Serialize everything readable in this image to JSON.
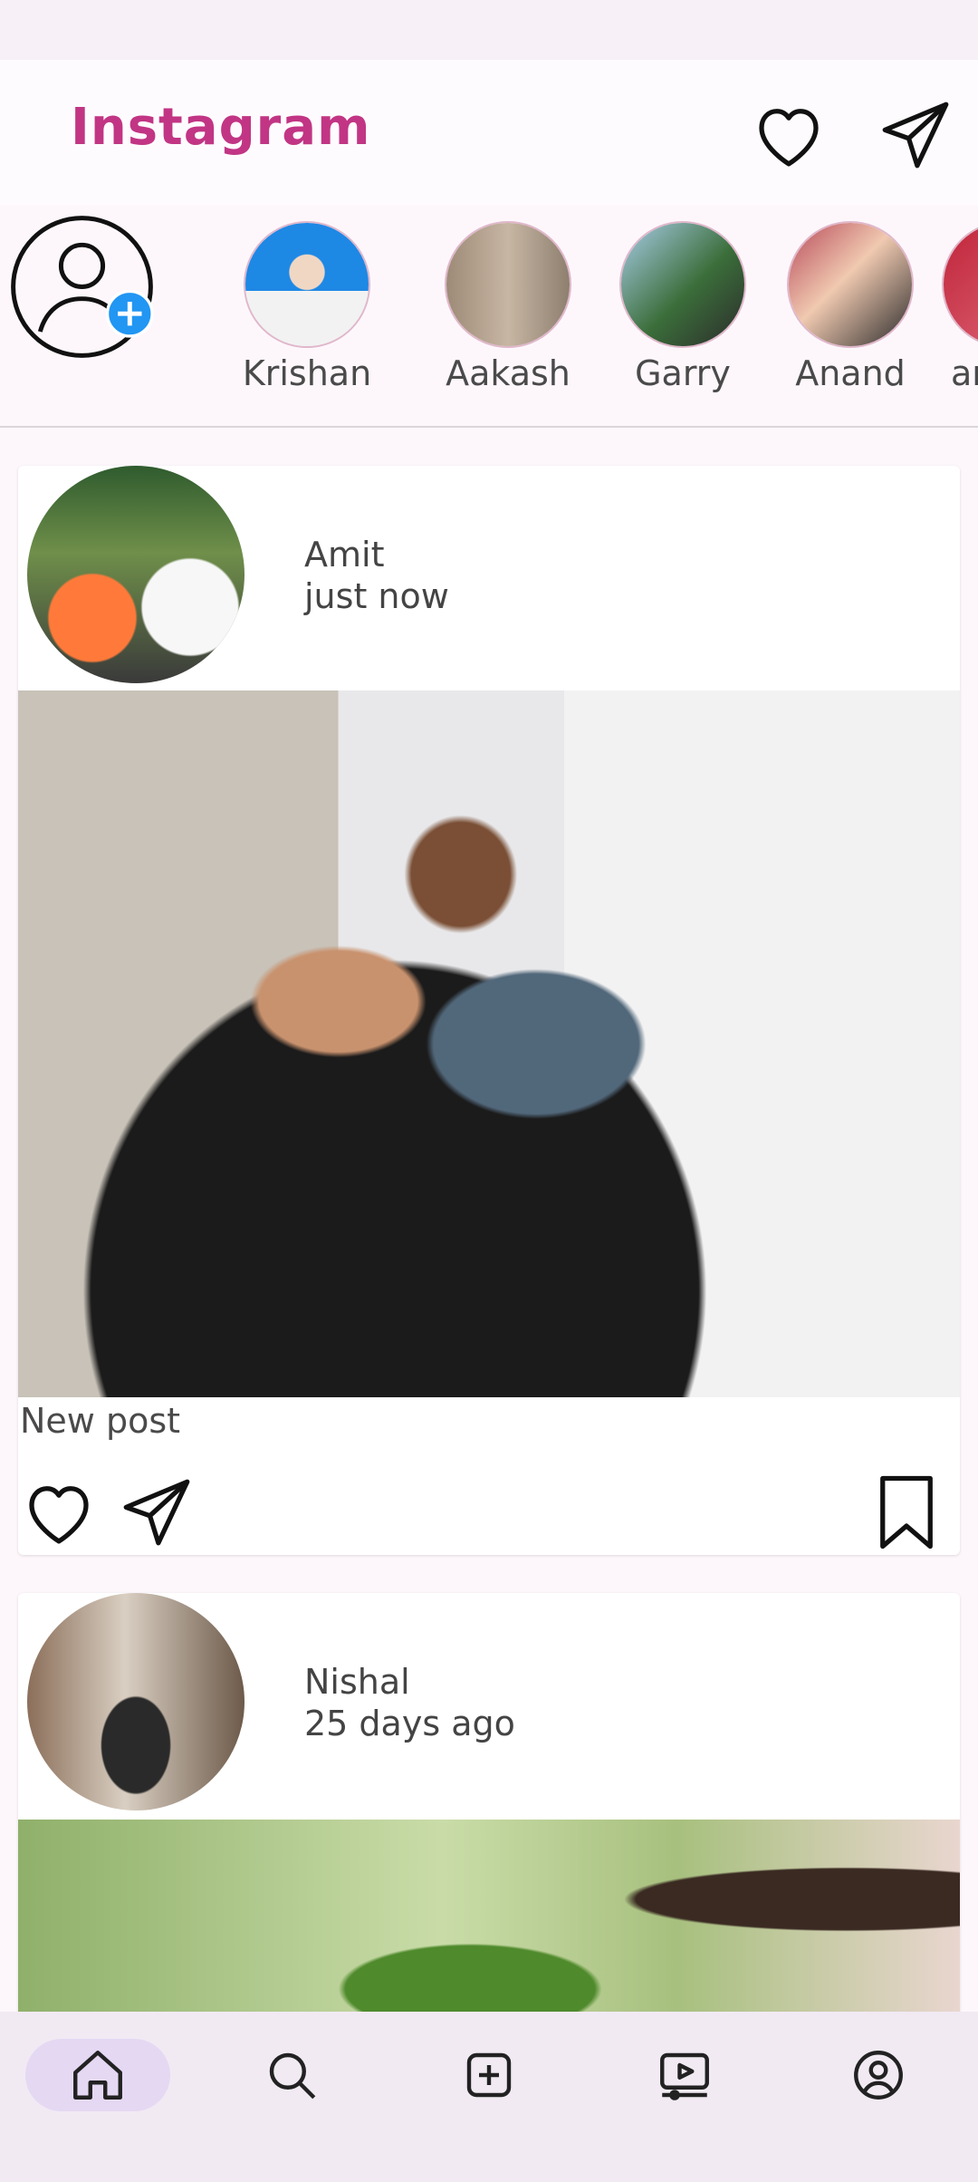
{
  "app": {
    "title": "Instagram"
  },
  "stories": [
    {
      "name": "Krishan"
    },
    {
      "name": "Aakash"
    },
    {
      "name": "Garry"
    },
    {
      "name": "Anand"
    },
    {
      "name": "ar"
    }
  ],
  "posts": [
    {
      "author": "Amit",
      "time": "just now",
      "caption": "New post"
    },
    {
      "author": "Nishal",
      "time": "25 days ago",
      "caption": ""
    }
  ],
  "nav": [
    "home-icon",
    "search-icon",
    "add-post-icon",
    "reels-icon",
    "profile-icon"
  ],
  "colors": {
    "brand": "#c13584",
    "nav_bg": "#f1eaf3",
    "nav_active": "#e5d8f3",
    "story_badge": "#2196f3"
  }
}
